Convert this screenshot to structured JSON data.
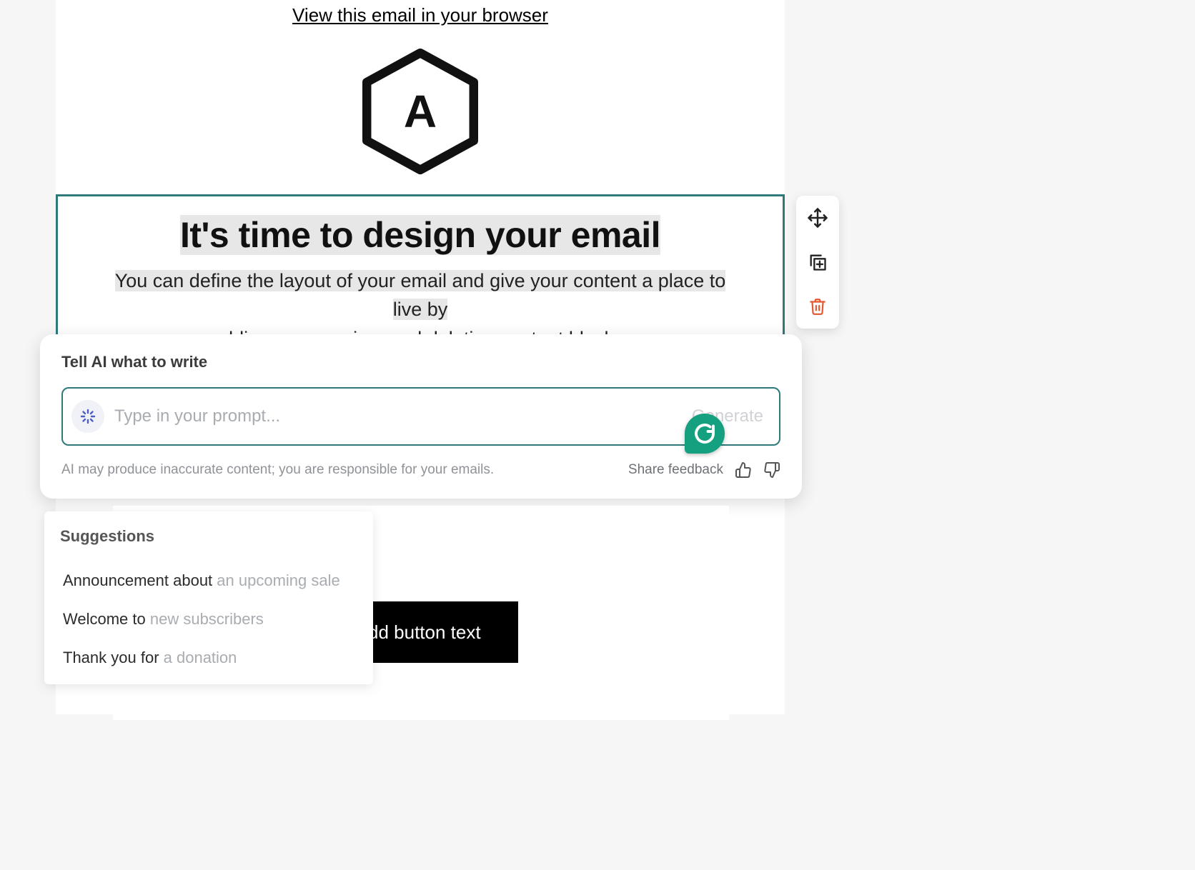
{
  "header": {
    "view_in_browser": "View this email in your browser",
    "logo_letter": "A"
  },
  "selected_block": {
    "headline": "It's time to design your email",
    "subhead_part1": "You can define the layout of your email and give your content a place to live by",
    "subhead_part2": "adding, rearranging, and deleting content blocks."
  },
  "ai_panel": {
    "title": "Tell AI what to write",
    "placeholder": "Type in your prompt...",
    "generate_label": "Generate",
    "disclaimer": "AI may produce inaccurate content; you are responsible for your emails.",
    "share_feedback": "Share feedback"
  },
  "suggestions": {
    "title": "Suggestions",
    "items": [
      {
        "prefix": "Announcement about ",
        "hint": "an upcoming sale"
      },
      {
        "prefix": "Welcome to ",
        "hint": "new subscribers"
      },
      {
        "prefix": "Thank you for ",
        "hint": "a donation"
      }
    ]
  },
  "cta": {
    "button_text": "dd button text"
  }
}
